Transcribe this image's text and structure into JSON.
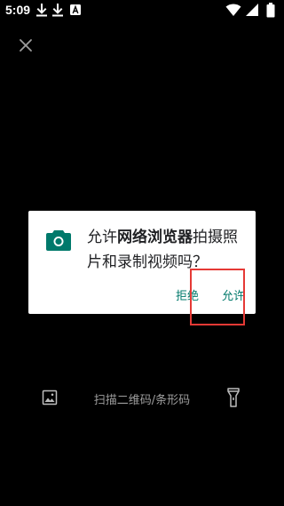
{
  "status_bar": {
    "time": "5:09",
    "notification_icons": [
      "download-icon",
      "download-icon",
      "font-a-icon"
    ],
    "system_icons": [
      "wifi-icon",
      "signal-icon",
      "battery-icon"
    ]
  },
  "top": {
    "close_icon": "close-icon"
  },
  "dialog": {
    "icon": "camera-icon",
    "accent_color": "#00796b",
    "message_prefix": "允许",
    "app_name": "网络浏览器",
    "message_suffix": "拍摄照片和录制视频吗？",
    "deny_label": "拒绝",
    "allow_label": "允许"
  },
  "annotation": {
    "color": "#e53935"
  },
  "scanner": {
    "gallery_icon": "image-icon",
    "hint": "扫描二维码/条形码",
    "flashlight_icon": "flashlight-icon"
  }
}
